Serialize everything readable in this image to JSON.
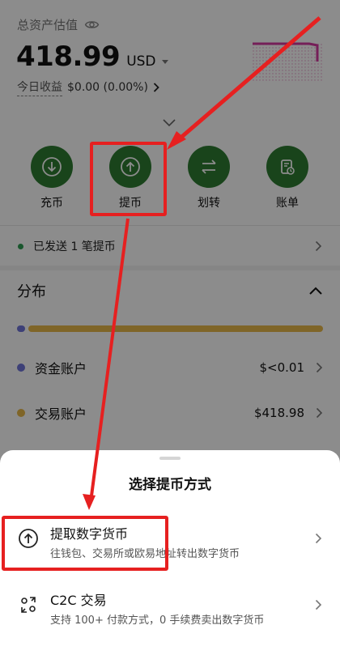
{
  "header": {
    "asset_label": "总资产估值",
    "balance": "418.99",
    "currency": "USD",
    "pnl_label": "今日收益",
    "pnl_value": "$0.00 (0.00%)"
  },
  "actions": [
    {
      "label": "充币",
      "icon": "download-circle-icon"
    },
    {
      "label": "提币",
      "icon": "upload-circle-icon"
    },
    {
      "label": "划转",
      "icon": "transfer-icon"
    },
    {
      "label": "账单",
      "icon": "bill-icon"
    }
  ],
  "notice": {
    "text": "已发送 1 笔提币"
  },
  "distribution": {
    "title": "分布",
    "accounts": [
      {
        "name": "资金账户",
        "value": "$<0.01",
        "color": "#6f76d9"
      },
      {
        "name": "交易账户",
        "value": "$418.98",
        "color": "#e8b84a"
      }
    ]
  },
  "sheet": {
    "title": "选择提币方式",
    "options": [
      {
        "title": "提取数字货币",
        "desc": "往钱包、交易所或欧易地址转出数字货币",
        "icon": "upload-circle-icon"
      },
      {
        "title": "C2C 交易",
        "desc": "支持 100+ 付款方式，0 手续费卖出数字货币",
        "icon": "c2c-exchange-icon"
      }
    ]
  },
  "colors": {
    "accent_green": "#2e7d32",
    "highlight_red": "#e62020",
    "sparkline_magenta": "#d63aa0"
  }
}
